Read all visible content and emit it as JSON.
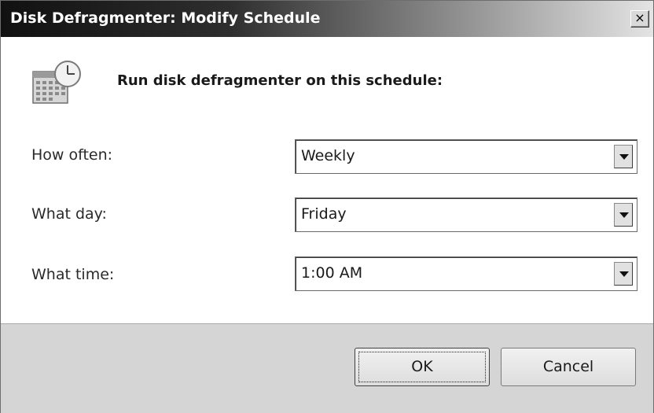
{
  "window": {
    "title": "Disk Defragmenter: Modify Schedule",
    "close_label": "×"
  },
  "header": {
    "icon": "calendar-clock-icon",
    "text": "Run disk defragmenter on this schedule:"
  },
  "fields": [
    {
      "label": "How often:",
      "value": "Weekly"
    },
    {
      "label": "What day:",
      "value": "Friday"
    },
    {
      "label": "What time:",
      "value": "1:00 AM"
    }
  ],
  "buttons": {
    "ok": "OK",
    "cancel": "Cancel"
  }
}
